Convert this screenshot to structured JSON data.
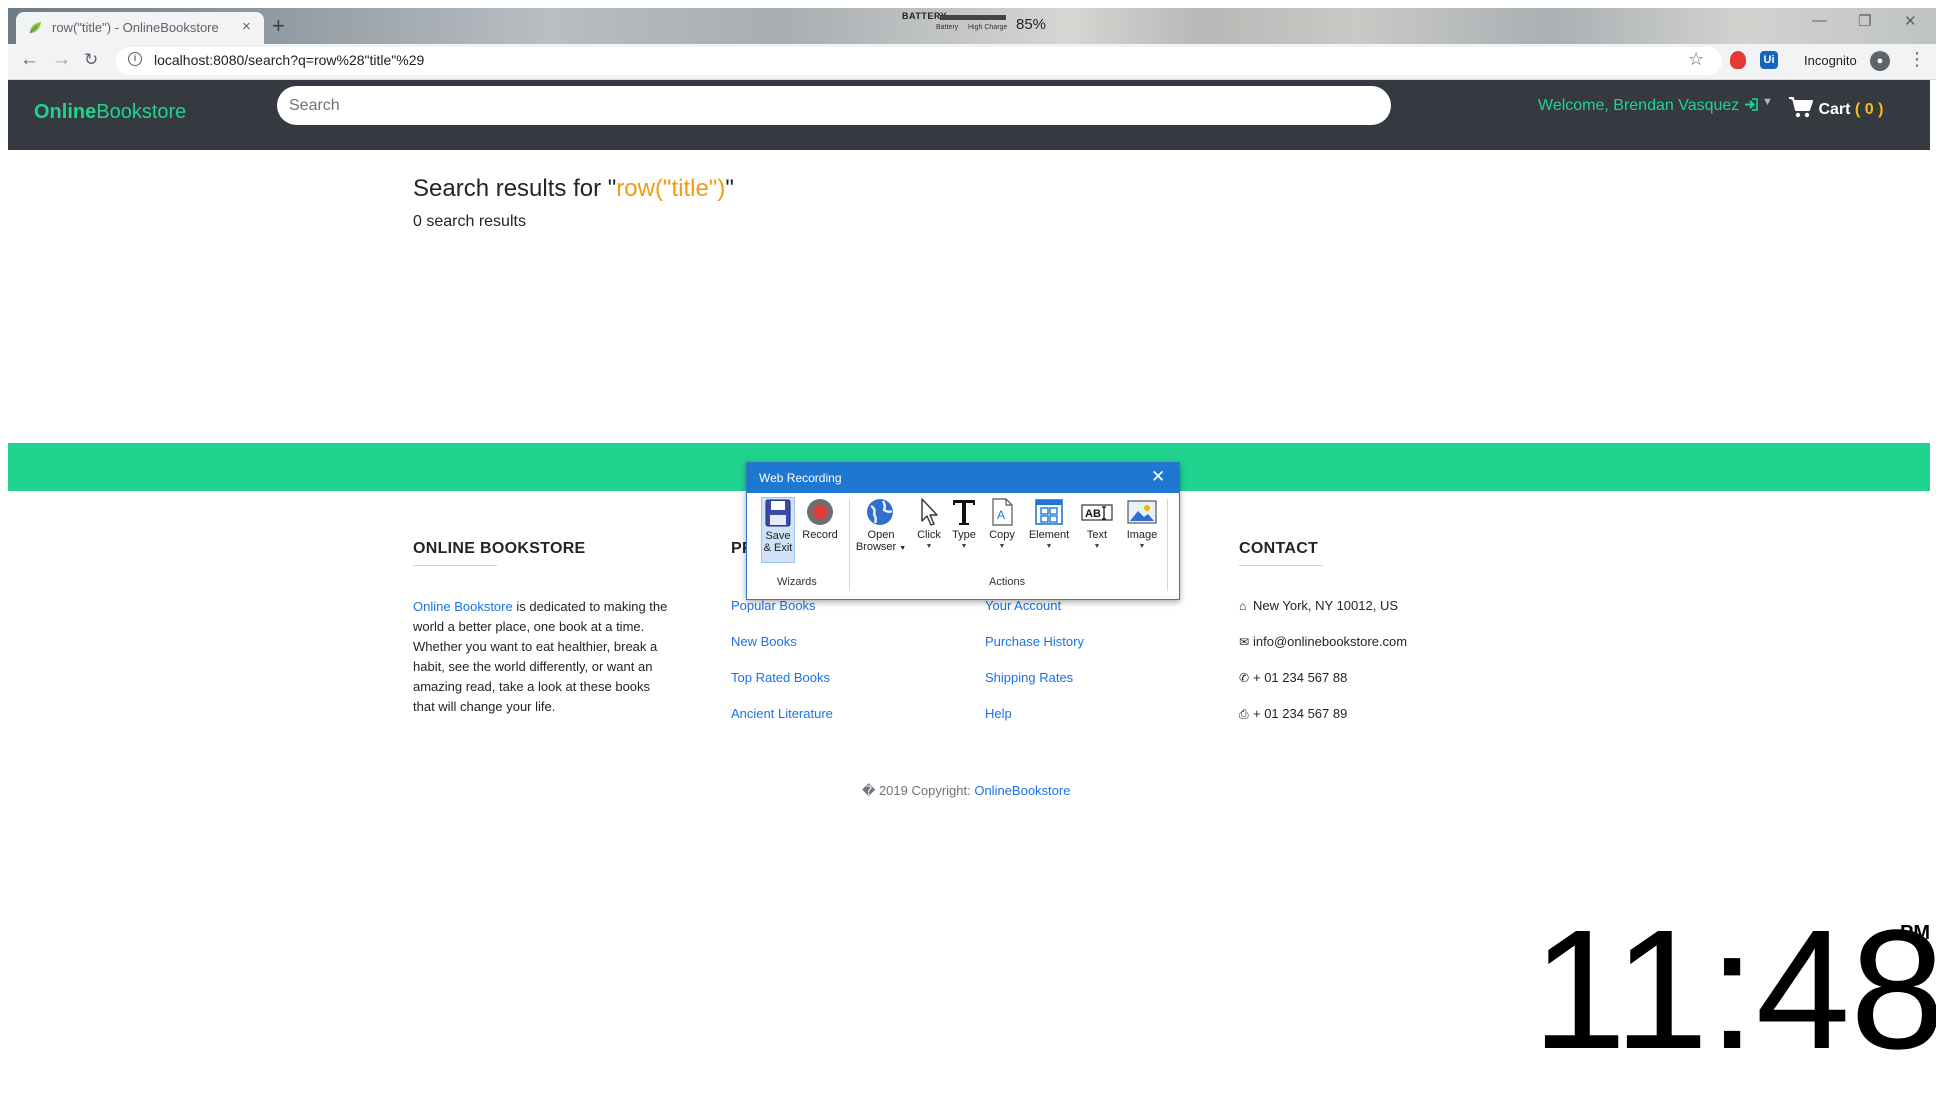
{
  "browser": {
    "tab_title": "row(\"title\") - OnlineBookstore",
    "tab_close": "×",
    "new_tab": "+",
    "url": "localhost:8080/search?q=row%28\"title\"%29",
    "incognito_label": "Incognito",
    "battery": {
      "label": "BATTERY",
      "sub_left": "Battery",
      "sub_right": "High Charge",
      "percent": "85%"
    }
  },
  "navbar": {
    "brand_bold": "Online",
    "brand_rest": "Bookstore",
    "search_placeholder": "Search",
    "welcome": "Welcome, Brendan Vasquez",
    "cart_label": "Cart",
    "cart_open": "(",
    "cart_count": "0",
    "cart_close": ")"
  },
  "results": {
    "prefix": "Search results for \"",
    "query": "row(\"title\")",
    "suffix": "\"",
    "count_text": "0 search results"
  },
  "footer": {
    "about_heading": "ONLINE BOOKSTORE",
    "about_link": "Online Bookstore",
    "about_text": " is dedicated to making the world a better place, one book at a time. Whether you want to eat healthier, break a habit, see the world differently, or want an amazing read, take a look at these books that will change your life.",
    "products_heading_visible": "PR",
    "products_links": [
      "Popular Books",
      "New Books",
      "Top Rated Books",
      "Ancient Literature"
    ],
    "account_links": [
      "Your Account",
      "Purchase History",
      "Shipping Rates",
      "Help"
    ],
    "contact_heading": "CONTACT",
    "contact": {
      "address": "New York, NY 10012, US",
      "email": "info@onlinebookstore.com",
      "phone": "+ 01 234 567 88",
      "fax": "+ 01 234 567 89"
    },
    "copyright_text": "� 2019 Copyright: ",
    "copyright_link": "OnlineBookstore"
  },
  "recorder": {
    "title": "Web Recording",
    "wizards": {
      "group_label": "Wizards",
      "save_exit": [
        "Save",
        "& Exit"
      ],
      "record": "Record"
    },
    "actions": {
      "group_label": "Actions",
      "open_browser": [
        "Open",
        "Browser"
      ],
      "click": "Click",
      "type": "Type",
      "copy": "Copy",
      "element": "Element",
      "text": "Text",
      "image": "Image"
    }
  },
  "clock": {
    "time": "11:48",
    "ampm": "PM"
  },
  "colors": {
    "navbar_bg": "#343a40",
    "accent_green": "#20d38f",
    "query_orange": "#f39c12",
    "cart_count_yellow": "#f7b924",
    "link_blue": "#1a73e8",
    "recorder_blue": "#1e78d2"
  },
  "icons": {
    "tab_favicon": "leaf-icon",
    "login": "sign-in-icon",
    "cart": "shopping-cart-icon",
    "address": "home-icon",
    "email": "envelope-icon",
    "phone": "phone-icon",
    "fax": "print-icon"
  }
}
